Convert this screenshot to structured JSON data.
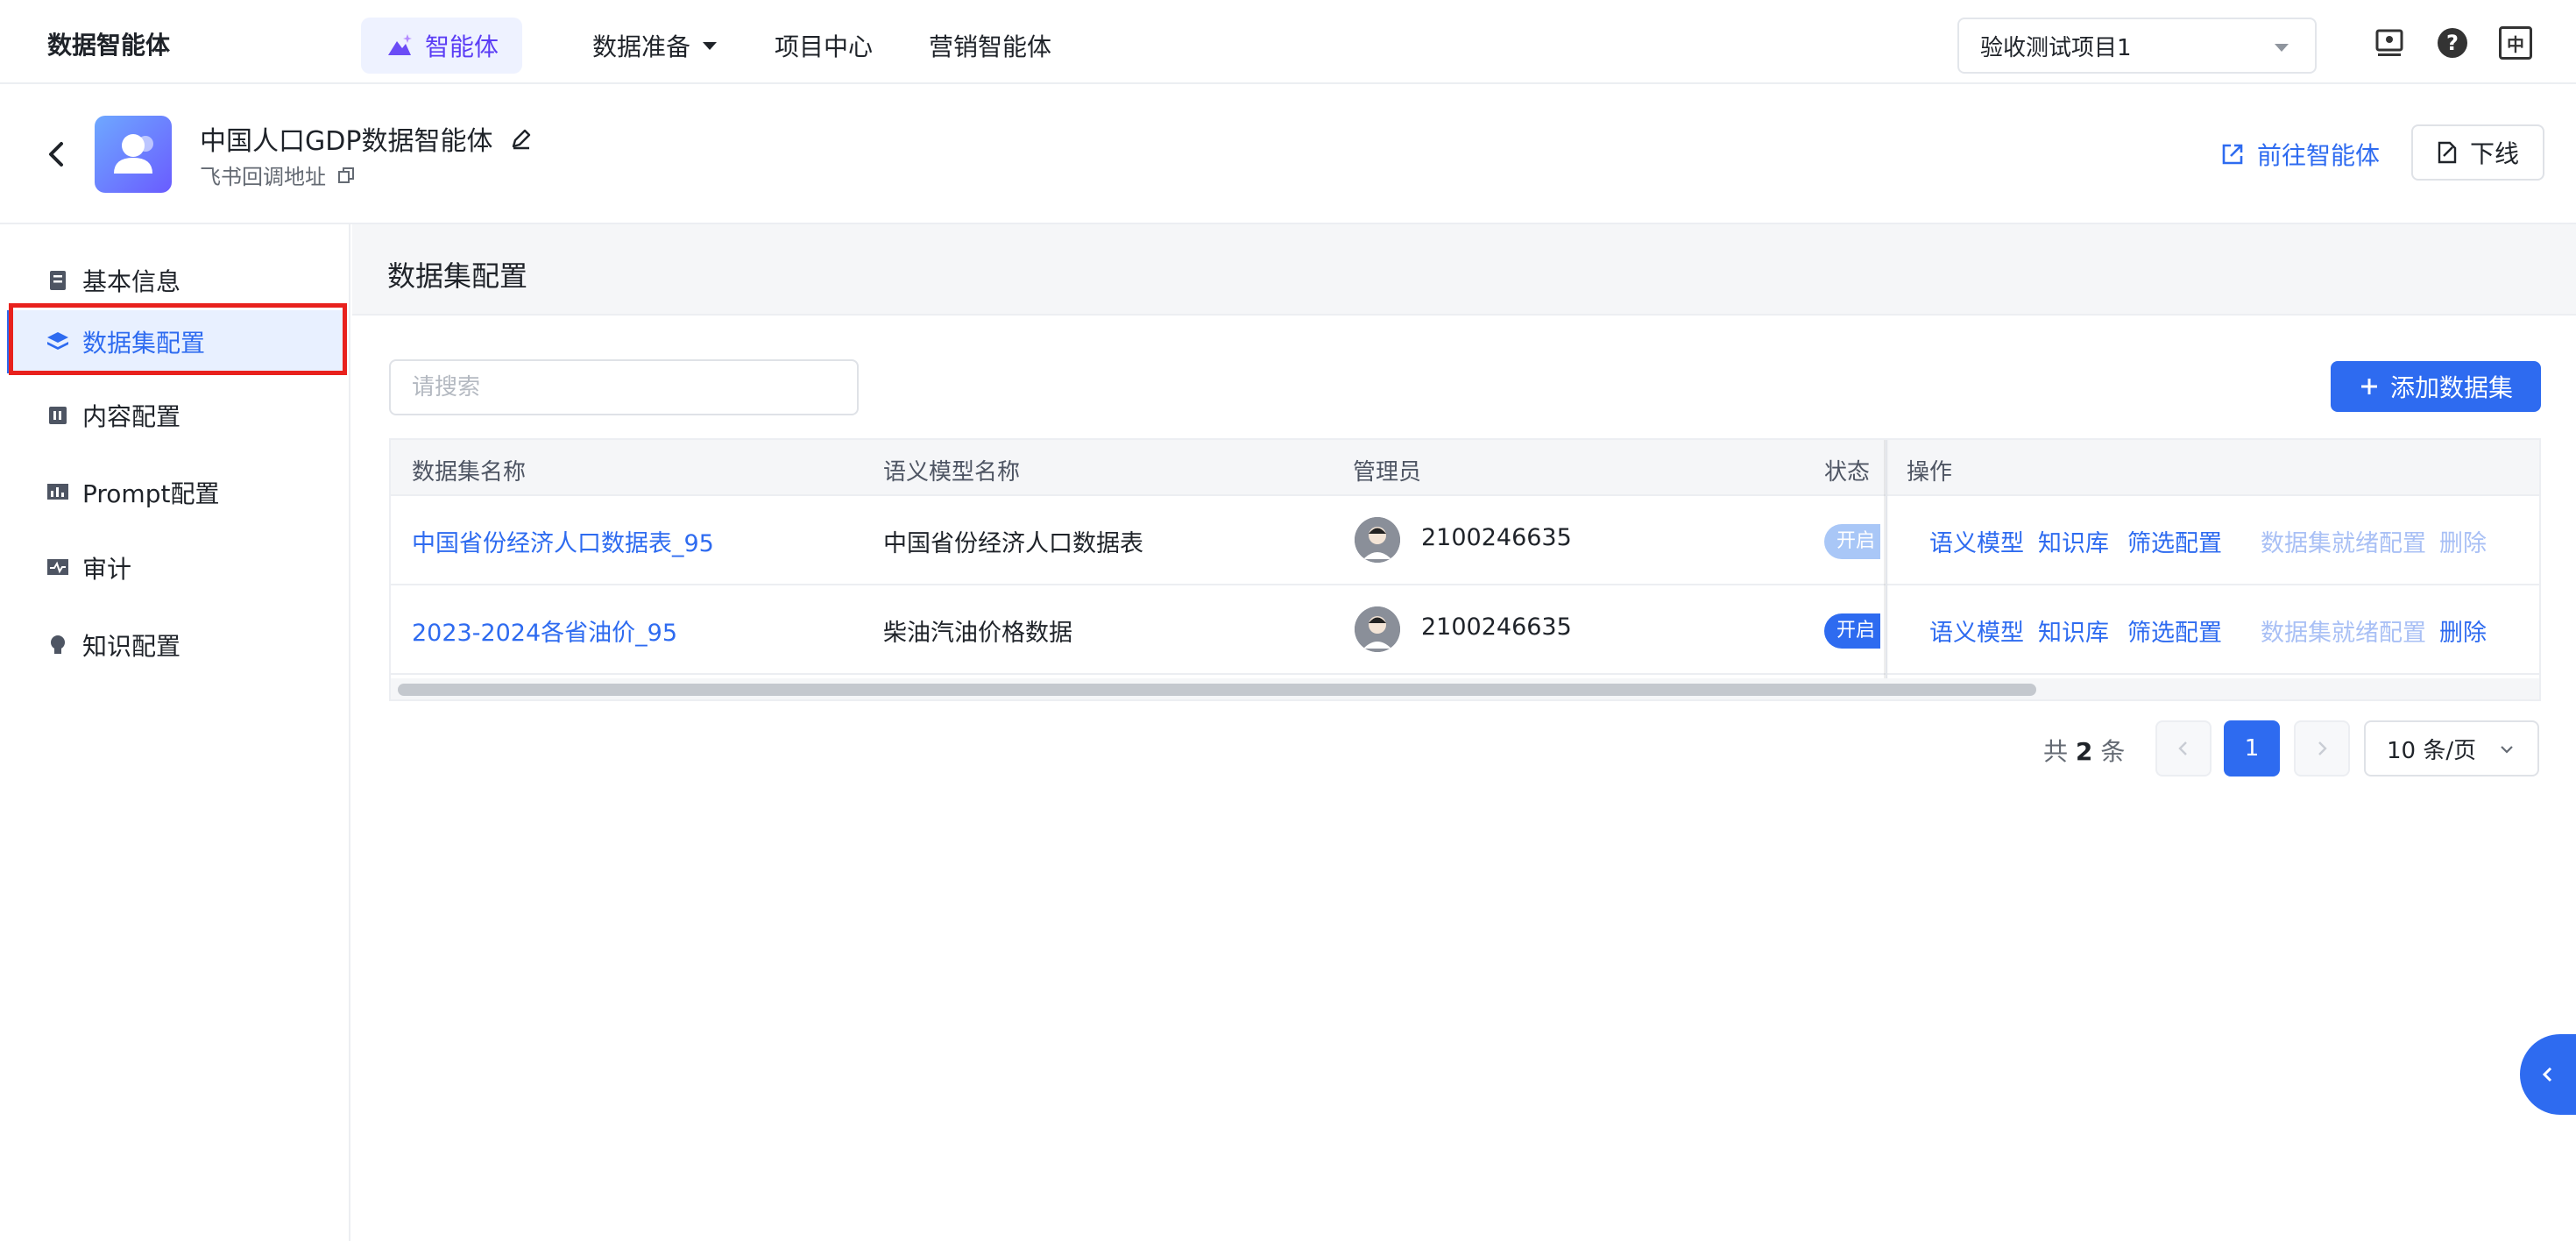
{
  "app": {
    "brand": "数据智能体"
  },
  "topnav": {
    "agent_tab": "智能体",
    "data_prep": "数据准备",
    "project_center": "项目中心",
    "marketing_agent": "营销智能体",
    "project_select_value": "验收测试项目1",
    "icons": [
      "monitor-icon",
      "help-icon",
      "language-icon"
    ],
    "language_label": "中"
  },
  "header": {
    "agent_name": "中国人口GDP数据智能体",
    "sub_label": "飞书回调地址",
    "goto_label": "前往智能体",
    "offline_label": "下线"
  },
  "sidebar": {
    "items": [
      {
        "label": "基本信息",
        "icon": "doc-icon"
      },
      {
        "label": "数据集配置",
        "icon": "layers-icon",
        "active": true
      },
      {
        "label": "内容配置",
        "icon": "content-icon"
      },
      {
        "label": "Prompt配置",
        "icon": "chart-icon"
      },
      {
        "label": "审计",
        "icon": "audit-icon"
      },
      {
        "label": "知识配置",
        "icon": "bulb-icon"
      }
    ]
  },
  "main": {
    "section_title": "数据集配置",
    "search_placeholder": "请搜索",
    "add_button": "添加数据集",
    "table": {
      "columns": [
        "数据集名称",
        "语义模型名称",
        "管理员",
        "状态",
        "操作"
      ],
      "rows": [
        {
          "dataset": "中国省份经济人口数据表_95",
          "model": "中国省份经济人口数据表",
          "admin": "2100246635",
          "status": "开启",
          "status_enabled": false,
          "ops": {
            "semantic": "语义模型",
            "knowledge": "知识库",
            "filter": "筛选配置",
            "ready": "数据集就绪配置",
            "delete": "删除"
          },
          "delete_enabled": false
        },
        {
          "dataset": "2023-2024各省油价_95",
          "model": "柴油汽油价格数据",
          "admin": "2100246635",
          "status": "开启",
          "status_enabled": true,
          "ops": {
            "semantic": "语义模型",
            "knowledge": "知识库",
            "filter": "筛选配置",
            "ready": "数据集就绪配置",
            "delete": "删除"
          },
          "delete_enabled": true
        }
      ]
    },
    "pagination": {
      "total_prefix": "共",
      "total": "2",
      "total_suffix": "条",
      "current_page": "1",
      "page_size": "10 条/页"
    }
  },
  "watermark_text": "2100246635",
  "colors": {
    "primary": "#2e6bf0",
    "agent_accent": "#5b3df5",
    "highlight": "#e8211d"
  }
}
